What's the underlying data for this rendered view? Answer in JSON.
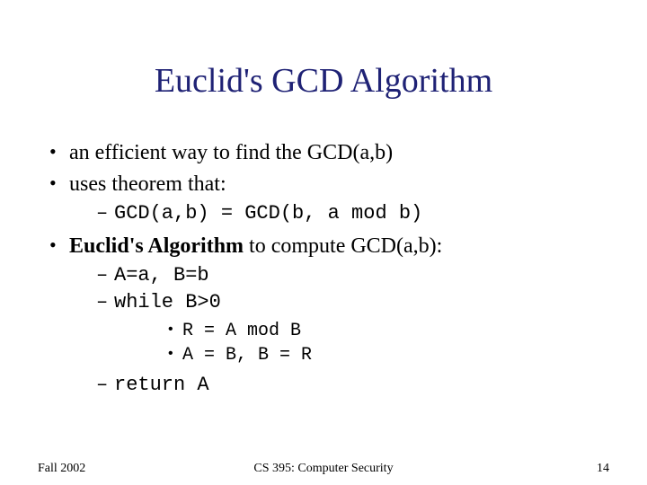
{
  "title": "Euclid's GCD Algorithm",
  "bullets": {
    "b1": "an efficient way to find the GCD(a,b)",
    "b2": "uses theorem that:",
    "b2_sub1": "GCD(a,b) = GCD(b, a mod b)",
    "b3_bold": "Euclid's Algorithm",
    "b3_rest": " to compute GCD(a,b):",
    "b3_sub1": "A=a, B=b",
    "b3_sub2": "while B>0",
    "b3_sub2_a": "R = A mod B",
    "b3_sub2_b": "A = B, B = R",
    "b3_sub3": "return A"
  },
  "footer": {
    "left": "Fall 2002",
    "center": "CS 395: Computer Security",
    "right": "14"
  }
}
